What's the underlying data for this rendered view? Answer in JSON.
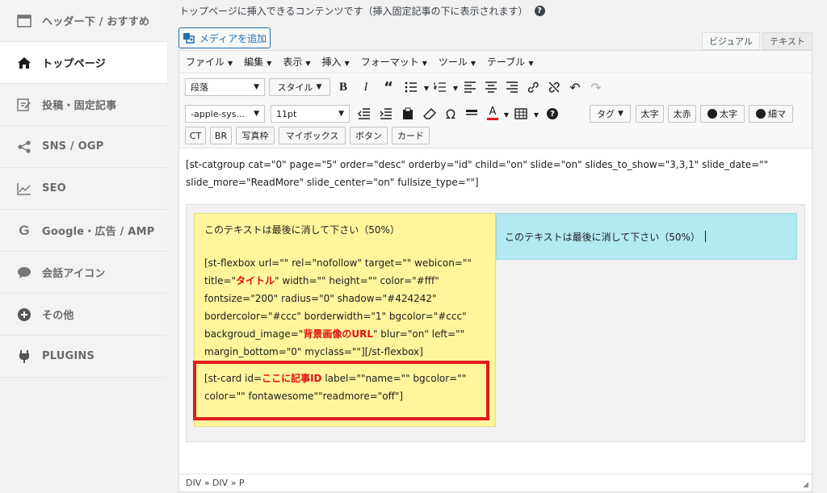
{
  "sidebar": {
    "items": [
      {
        "label": "ヘッダー下 / おすすめ",
        "icon": "header-layout-icon"
      },
      {
        "label": "トップページ",
        "icon": "home-icon",
        "active": true
      },
      {
        "label": "投稿・固定記事",
        "icon": "edit-post-icon"
      },
      {
        "label": "SNS / OGP",
        "icon": "share-icon"
      },
      {
        "label": "SEO",
        "icon": "chart-line-icon"
      },
      {
        "label": "Google・広告 / AMP",
        "icon": "google-icon"
      },
      {
        "label": "会話アイコン",
        "icon": "speech-bubble-icon"
      },
      {
        "label": "その他",
        "icon": "plus-circle-icon"
      },
      {
        "label": "PLUGINS",
        "icon": "plug-icon"
      }
    ]
  },
  "main": {
    "description": "トップページに挿入できるコンテンツです（挿入固定記事の下に表示されます）",
    "help": "?",
    "media_button": "メディアを追加",
    "tabs": {
      "visual": "ビジュアル",
      "text": "テキスト"
    }
  },
  "editor": {
    "menu": [
      "ファイル",
      "編集",
      "表示",
      "挿入",
      "フォーマット",
      "ツール",
      "テーブル"
    ],
    "toolbar": {
      "format_select": "段落",
      "style_select": "スタイル",
      "font_select": "-apple-sys...",
      "size_select": "11pt",
      "tag_select": "タグ",
      "buttons_row2": [
        "太字",
        "太赤",
        "太字",
        "細マ"
      ],
      "buttons_row3": [
        "CT",
        "BR",
        "写真枠",
        "マイボックス",
        "ボタン",
        "カード"
      ]
    },
    "content": {
      "shortcode_line1": "[st-catgroup cat=\"0\" page=\"5\" order=\"desc\" orderby=\"id\" child=\"on\" slide=\"on\" slides_to_show=\"3,3,1\" slide_date=\"\"",
      "shortcode_line2": "slide_more=\"ReadMore\" slide_center=\"on\" fullsize_type=\"\"]",
      "yellow_heading": "このテキストは最後に消して下さい（50%）",
      "blue_text": "このテキストは最後に消して下さい（50%）",
      "flex": {
        "l1a": "[st-flexbox url=\"\" rel=\"nofollow\" target=\"\" webicon=\"\"",
        "l2a": "title=\"",
        "l2red": "タイトル",
        "l2b": "\" width=\"\" height=\"\" color=\"#fff\"",
        "l3": "fontsize=\"200\" radius=\"0\" shadow=\"#424242\"",
        "l4": "bordercolor=\"#ccc\" borderwidth=\"1\" bgcolor=\"#ccc\"",
        "l5a": "backgroud_image=\"",
        "l5red": "背景画像のURL",
        "l5b": "\" blur=\"on\" left=\"\"",
        "l6": "margin_bottom=\"0\" myclass=\"\"][/st-flexbox]"
      },
      "card": {
        "l1a": "[st-card id=",
        "l1red": "ここに記事ID",
        "l1b": " label=\"\"name=\"\" bgcolor=\"\"",
        "l2": "color=\"\" fontawesome\"\"readmore=\"off\"]"
      }
    },
    "status_path": "DIV » DIV » P"
  },
  "colors": {
    "accent": "#2271b1",
    "highlight_red": "#e31b1b",
    "yellow_bg": "#fff59d",
    "blue_bg": "#b3e9f1"
  }
}
